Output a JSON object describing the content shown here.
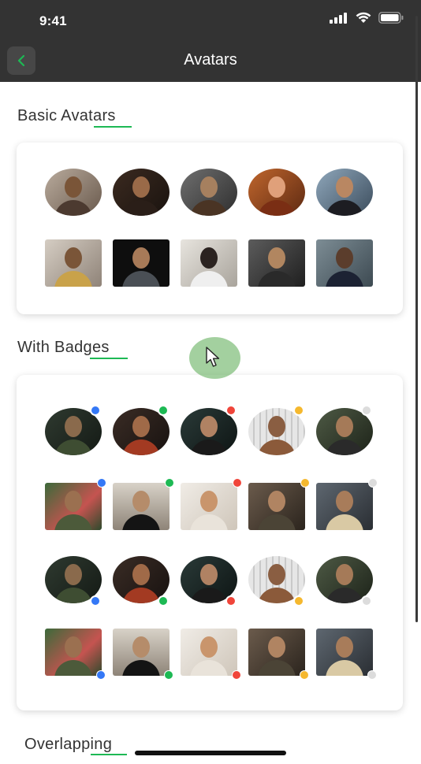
{
  "status_bar": {
    "time": "9:41"
  },
  "nav": {
    "title": "Avatars",
    "back_icon": "chevron-left-icon"
  },
  "colors": {
    "accent": "#1db954",
    "blue": "#3478f6",
    "green": "#1db954",
    "red": "#f0453a",
    "yellow": "#f5b82e",
    "gray": "#dcdcdc"
  },
  "sections": [
    {
      "title": "Basic Avatars"
    },
    {
      "title": "With Badges"
    },
    {
      "title": "Overlapping"
    }
  ],
  "basic_avatars": {
    "circle_row": [
      "photo-woman-city",
      "photo-man-dark-hair",
      "photo-man-beard-jacket",
      "photo-woman-red-hair",
      "photo-man-black-shirt"
    ],
    "square_row": [
      "photo-woman-scarf",
      "photo-man-glasses",
      "photo-woman-white-top",
      "photo-man-jacket",
      "photo-woman-dark-coat"
    ]
  },
  "badge_avatars": {
    "badge_colors": [
      "blue",
      "green",
      "red",
      "yellow",
      "gray"
    ],
    "rows": [
      {
        "shape": "circle",
        "badge_position": "top-right"
      },
      {
        "shape": "square",
        "badge_position": "top-right"
      },
      {
        "shape": "circle",
        "badge_position": "bottom-right"
      },
      {
        "shape": "square",
        "badge_position": "bottom-right"
      }
    ]
  }
}
